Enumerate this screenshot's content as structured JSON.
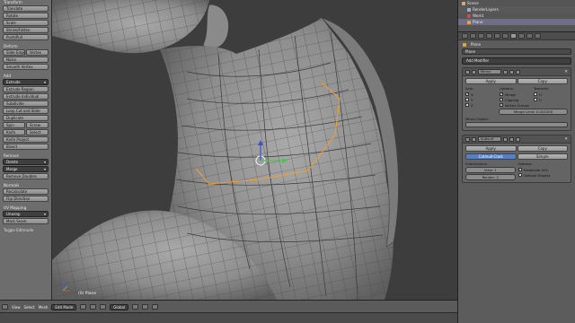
{
  "toolshelf": {
    "sections": [
      {
        "title": "Transform",
        "buttons": [
          "Translate",
          "Rotate",
          "Scale",
          "Shrink/Fatten",
          "Push/Pull"
        ]
      },
      {
        "title": "Deform",
        "buttons": [
          "Slide Edge",
          "Vertex",
          "Noise",
          "Smooth Vertex"
        ]
      },
      {
        "title": "Add",
        "dropdown": "Extrude",
        "buttons": [
          "Extrude Region",
          "Extrude Individual",
          "Subdivide",
          "Loop Cut and Slide",
          "Duplicate",
          "Spin",
          "Screw",
          "Knife",
          "Select",
          "Knife Project",
          "Bisect"
        ]
      },
      {
        "title": "Remove",
        "dropdowns": [
          "Delete",
          "Merge"
        ],
        "buttons": [
          "Remove Doubles"
        ]
      },
      {
        "title": "Normals",
        "buttons": [
          "Recalculate",
          "Flip Direction"
        ]
      },
      {
        "title": "UV Mapping",
        "dropdown": "Unwrap",
        "buttons": [
          "Mark Seam"
        ]
      }
    ],
    "toggle": "Toggle Editmode"
  },
  "viewport": {
    "object_label": "(0) Plane"
  },
  "header": {
    "menus": [
      "View",
      "Select",
      "Mesh"
    ],
    "mode": "Edit Mode",
    "orientation": "Global"
  },
  "outliner": {
    "rows": [
      {
        "label": "Scene",
        "color": "#c9b27a"
      },
      {
        "label": "RenderLayers",
        "color": "#9cb0c9"
      },
      {
        "label": "World",
        "color": "#c94f4f"
      },
      {
        "label": "Plane",
        "color": "#e5a33b",
        "selected": true
      }
    ]
  },
  "properties": {
    "path": [
      "Plane"
    ],
    "object_name": "Plane",
    "add_modifier": "Add Modifier",
    "mirror": {
      "name": "Mirror",
      "apply": "Apply",
      "copy": "Copy",
      "axis_label": "Axis:",
      "options_label": "Options:",
      "textures_label": "Textures:",
      "axes": [
        "X",
        "Y",
        "Z"
      ],
      "options": [
        "Merge",
        "Clipping",
        "Vertex Groups"
      ],
      "textures": [
        "U",
        "V"
      ],
      "merge_limit": "Merge Limit: 0.001000",
      "mirror_object_label": "Mirror Object:"
    },
    "subsurf": {
      "name": "Subsurf",
      "apply": "Apply",
      "copy": "Copy",
      "catmull": "Catmull-Clark",
      "simple": "Simple",
      "subdivisions_label": "Subdivisions:",
      "options_label": "Options:",
      "view": "View: 1",
      "render": "Render: 2",
      "opt1": "Subdivide UVs",
      "opt2": "Optimal Display"
    }
  }
}
